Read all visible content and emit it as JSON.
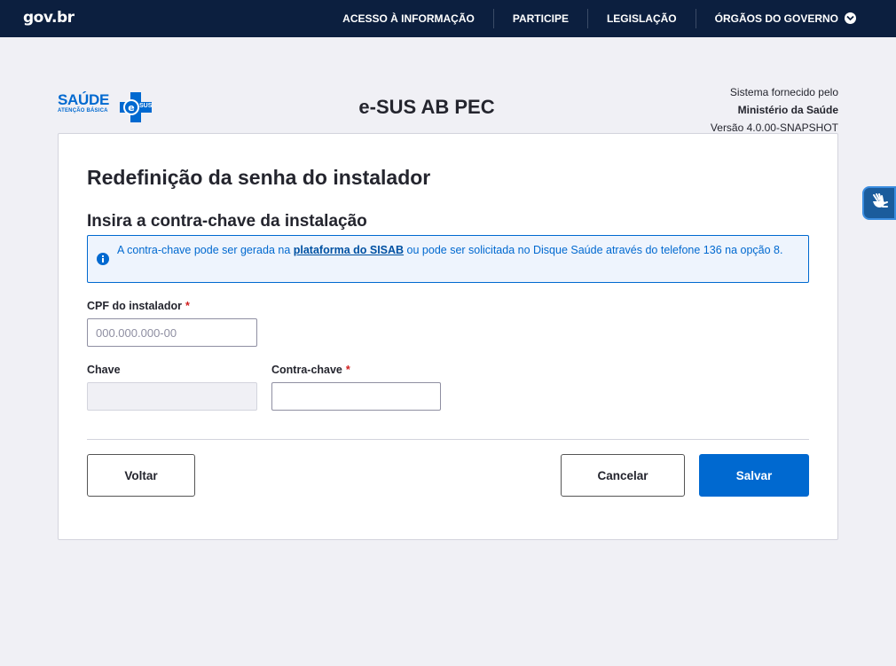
{
  "govbar": {
    "logo": "gov.br",
    "links": [
      {
        "label": "ACESSO À INFORMAÇÃO"
      },
      {
        "label": "PARTICIPE"
      },
      {
        "label": "LEGISLAÇÃO"
      },
      {
        "label": "ÓRGÃOS DO GOVERNO"
      }
    ]
  },
  "header": {
    "logo_main": "SAÚDE",
    "logo_badge": "SUS",
    "logo_sub": "ATENÇÃO BÁSICA",
    "title": "e-SUS AB PEC",
    "provider_line1": "Sistema fornecido pelo",
    "provider_line2": "Ministério da Saúde",
    "provider_line3": "Versão 4.0.00-SNAPSHOT"
  },
  "form": {
    "heading": "Redefinição da senha do instalador",
    "subheading": "Insira a contra-chave da instalação",
    "alert": {
      "before": "A contra-chave pode ser gerada na ",
      "link": "plataforma do SISAB",
      "after": " ou pode ser solicitada no Disque Saúde através do telefone 136 na opção 8."
    },
    "cpf_label": "CPF do instalador",
    "cpf_placeholder": "000.000.000-00",
    "cpf_value": "",
    "chave_label": "Chave",
    "chave_value": "",
    "contra_label": "Contra-chave",
    "contra_value": "",
    "required_mark": "*"
  },
  "buttons": {
    "back": "Voltar",
    "cancel": "Cancelar",
    "save": "Salvar"
  },
  "colors": {
    "primary": "#0069d0",
    "govbar": "#0c1f3f",
    "required": "#d01e1e"
  },
  "icons": {
    "info": "info-icon",
    "chevron": "chevron-down-icon",
    "accessibility": "sign-language-icon"
  }
}
